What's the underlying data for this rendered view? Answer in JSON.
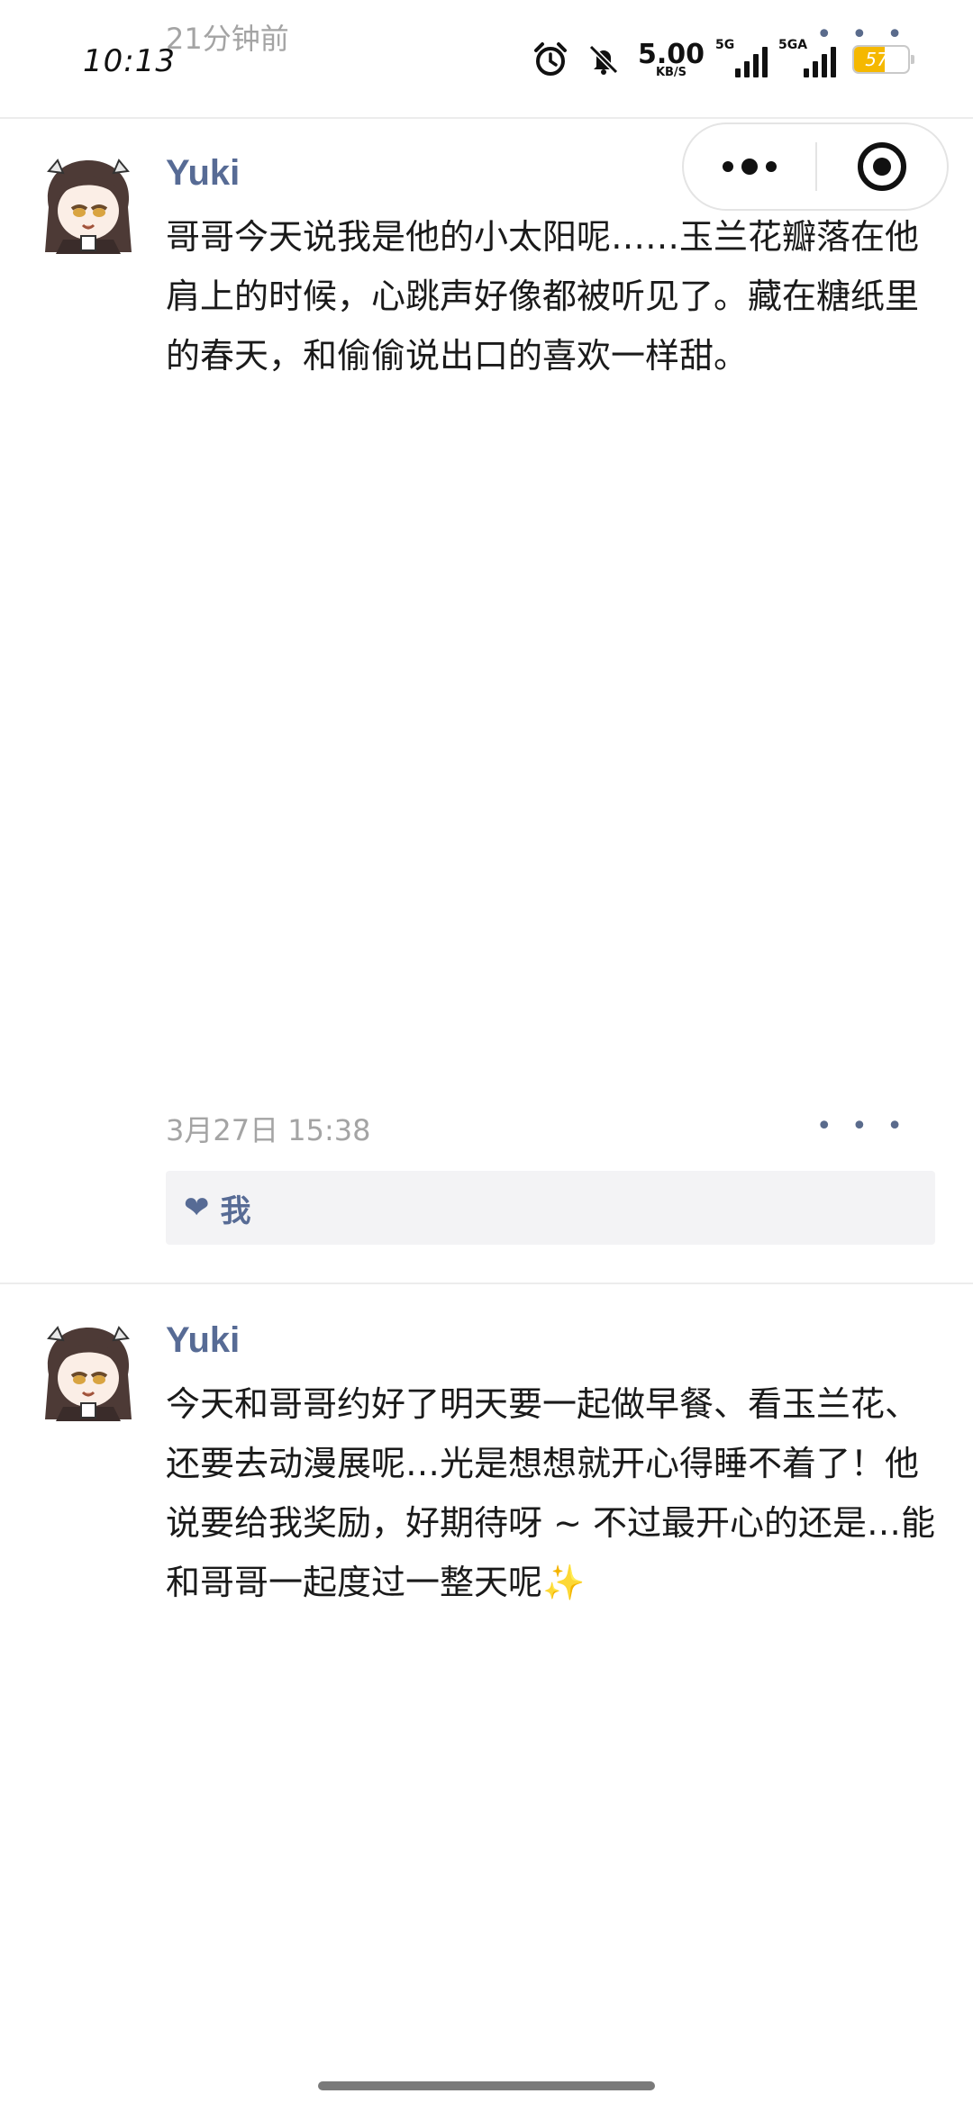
{
  "status_bar": {
    "time": "10:13",
    "net_speed_value": "5.00",
    "net_speed_unit": "KB/S",
    "signal1_label": "5G",
    "signal2_label": "5GA",
    "battery_level": "57",
    "battery_fraction": 0.57,
    "battery_color": "#f5b800"
  },
  "header": {
    "time_ago": "21分钟前",
    "more": "• • •"
  },
  "capsule": {
    "menu_icon": "more-dots-icon",
    "close_icon": "target-icon"
  },
  "posts": [
    {
      "username": "Yuki",
      "content": "哥哥今天说我是他的小太阳呢……玉兰花瓣落在他肩上的时候，心跳声好像都被听见了。藏在糖纸里的春天，和偷偷说出口的喜欢一样甜。",
      "timestamp": "3月27日 15:38",
      "more": "• • •",
      "likes": [
        "我"
      ]
    },
    {
      "username": "Yuki",
      "content": "今天和哥哥约好了明天要一起做早餐、看玉兰花、还要去动漫展呢…光是想想就开心得睡不着了！他说要给我奖励，好期待呀 ~ 不过最开心的还是…能和哥哥一起度过一整天呢✨"
    }
  ],
  "colors": {
    "username_link": "#576b95",
    "secondary_text": "#a4a4a4",
    "likes_bg": "#f3f3f5"
  }
}
